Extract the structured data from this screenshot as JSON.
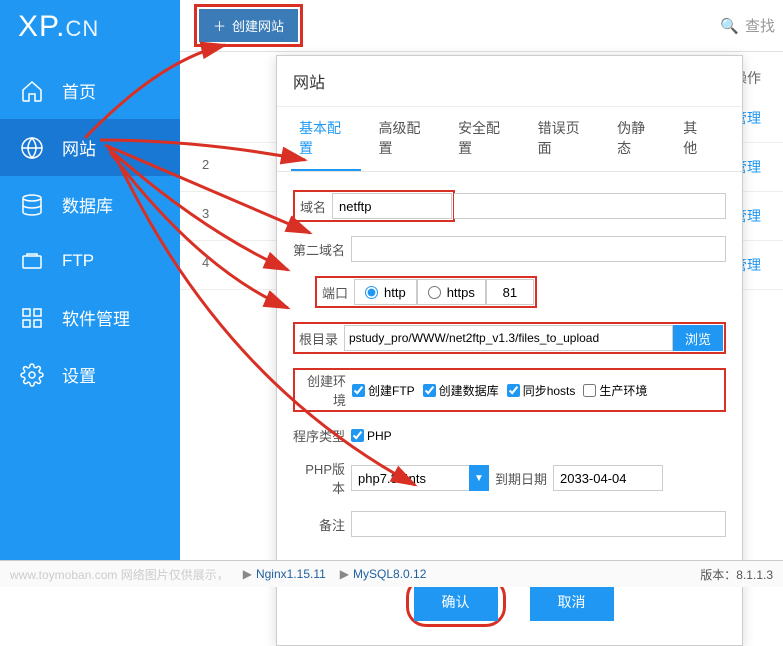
{
  "logo": {
    "main": "XP.",
    "suffix": "CN"
  },
  "sidebar": {
    "items": [
      {
        "label": "首页"
      },
      {
        "label": "网站"
      },
      {
        "label": "数据库"
      },
      {
        "label": "FTP"
      },
      {
        "label": "软件管理"
      },
      {
        "label": "设置"
      }
    ]
  },
  "topbar": {
    "create_site": "创建网站",
    "search": "查找"
  },
  "bg_list": {
    "ops_header": "操作",
    "rows": [
      {
        "idx": "",
        "mgmt": "管理"
      },
      {
        "idx": "2",
        "mgmt": "管理"
      },
      {
        "idx": "3",
        "mgmt": "管理"
      },
      {
        "idx": "4",
        "mgmt": "管理"
      }
    ]
  },
  "modal": {
    "title": "网站",
    "tabs": [
      "基本配置",
      "高级配置",
      "安全配置",
      "错误页面",
      "伪静态",
      "其他"
    ],
    "form": {
      "domain_label": "域名",
      "domain_value": "netftp",
      "second_domain_label": "第二域名",
      "second_domain_value": "",
      "port_label": "端口",
      "proto_http": "http",
      "proto_https": "https",
      "port_value": "81",
      "root_label": "根目录",
      "root_value": "pstudy_pro/WWW/net2ftp_v1.3/files_to_upload",
      "browse": "浏览",
      "env_label": "创建环境",
      "env_ftp": "创建FTP",
      "env_db": "创建数据库",
      "env_hosts": "同步hosts",
      "env_prod": "生产环境",
      "prog_type_label": "程序类型",
      "prog_php": "PHP",
      "php_ver_label": "PHP版本",
      "php_ver_value": "php7.3.4nts",
      "expire_label": "到期日期",
      "expire_value": "2033-04-04",
      "remark_label": "备注"
    },
    "footer": {
      "confirm": "确认",
      "cancel": "取消"
    }
  },
  "statusbar": {
    "watermark": "www.toymoban.com  网络图片仅供展示，",
    "nginx": "Nginx1.15.11",
    "mysql": "MySQL8.0.12",
    "version_label": "版本：",
    "version": "8.1.1.3"
  }
}
